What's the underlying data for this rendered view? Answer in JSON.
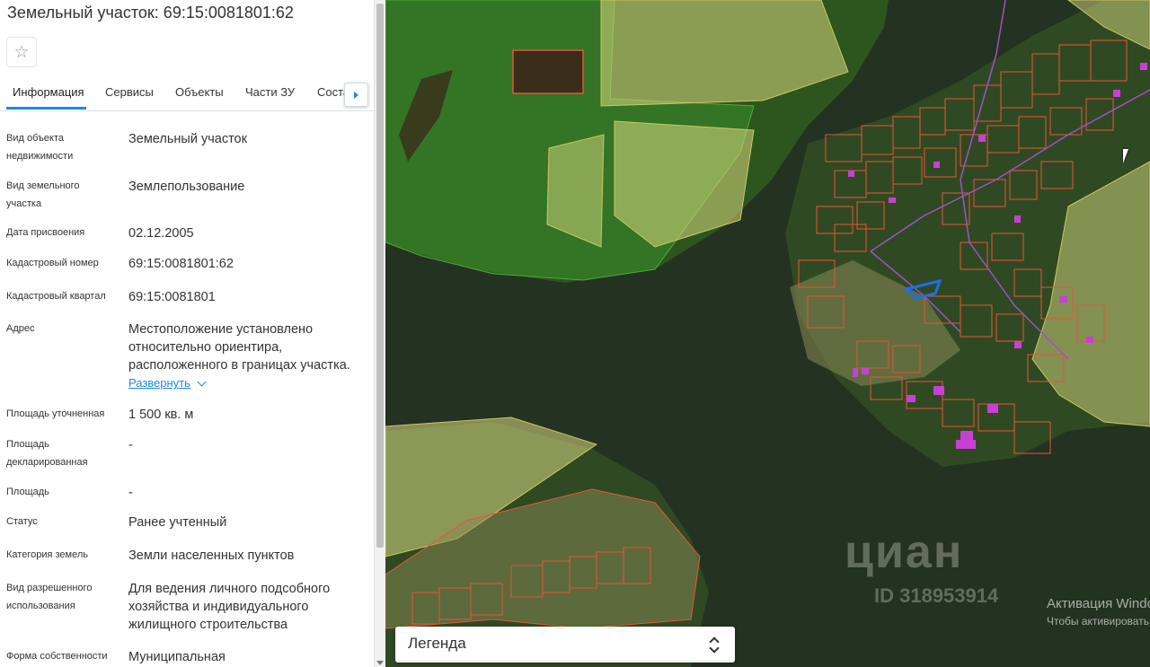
{
  "panel": {
    "title": "Земельный участок: 69:15:0081801:62",
    "favorite_icon": "star-outline-icon",
    "tabs": [
      "Информация",
      "Сервисы",
      "Объекты",
      "Части ЗУ",
      "Соста"
    ],
    "active_tab": "Информация",
    "rows": [
      {
        "label": "Вид объекта недвижимости",
        "value": "Земельный участок"
      },
      {
        "label": "Вид земельного участка",
        "value": "Землепользование"
      },
      {
        "label": "Дата присвоения",
        "value": "02.12.2005"
      },
      {
        "label": "Кадастровый номер",
        "value": "69:15:0081801:62"
      },
      {
        "label": "Кадастровый квартал",
        "value": "69:15:0081801"
      },
      {
        "label": "Адрес",
        "value": "Местоположение установлено относительно ориентира, расположенного в границах участка.",
        "link": "Развернуть"
      },
      {
        "label": "Площадь уточненная",
        "value": "1 500 кв. м"
      },
      {
        "label": "Площадь декларированная",
        "value": "-"
      },
      {
        "label": "Площадь",
        "value": "-"
      },
      {
        "label": "Статус",
        "value": "Ранее учтенный"
      },
      {
        "label": "Категория земель",
        "value": "Земли населенных пунктов"
      },
      {
        "label": "Вид разрешенного использования",
        "value": "Для ведения личного подсобного хозяйства и индивидуального жилищного строительства"
      },
      {
        "label": "Форма собственности",
        "value": "Муниципальная"
      }
    ]
  },
  "map": {
    "legend_label": "Легенда",
    "watermark_logo": "циан",
    "watermark_id": "ID 318953914",
    "activation_line1": "Активация Windows",
    "activation_line2": "Чтобы активировать Windows",
    "colors": {
      "water": "#23321f",
      "forest": "#2f5a1f",
      "forest_zone_fill": "#3f9a2e",
      "yellow_zone_fill": "#d8d880",
      "parcel_outline": "#e8543a",
      "selected_parcel": "#1e6cf0",
      "building": "#c93fd6"
    }
  }
}
